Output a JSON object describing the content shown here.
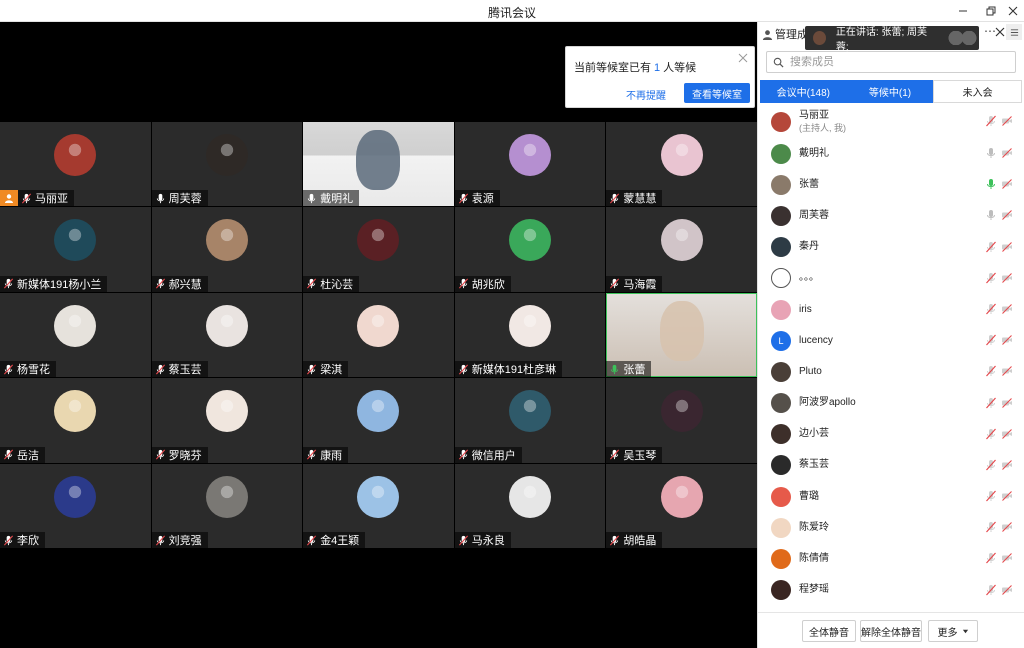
{
  "window": {
    "title": "腾讯会议"
  },
  "popup": {
    "prefix": "当前等候室已有",
    "count": "1",
    "suffix": "人等候",
    "dismiss_label": "不再提醒",
    "view_label": "查看等候室"
  },
  "speaking": {
    "text": "正在讲话: 张蕾; 周芙蓉;"
  },
  "panel": {
    "title": "管理成员",
    "search_placeholder": "搜索成员",
    "tabs": [
      {
        "label": "会议中(148)",
        "active": true
      },
      {
        "label": "等候中(1)",
        "active": false
      },
      {
        "label": "未入会",
        "active": false
      }
    ],
    "members": [
      {
        "name": "马丽亚",
        "sub": "(主持人, 我)",
        "mic": "muted",
        "color": "#b5473a"
      },
      {
        "name": "戴明礼",
        "sub": "",
        "mic": "idle",
        "color": "#4c8a4a"
      },
      {
        "name": "张蕾",
        "sub": "",
        "mic": "speaking",
        "color": "#8a7a6a"
      },
      {
        "name": "周芙蓉",
        "sub": "",
        "mic": "idle",
        "color": "#3a3130"
      },
      {
        "name": "秦丹",
        "sub": "",
        "mic": "muted",
        "color": "#2d3b45"
      },
      {
        "name": "。。。",
        "sub": "",
        "mic": "muted",
        "color": "#ffffff"
      },
      {
        "name": "iris",
        "sub": "",
        "mic": "muted",
        "color": "#e8a3b5"
      },
      {
        "name": "lucency",
        "sub": "",
        "mic": "muted",
        "color": "#1e6fe8",
        "letter": "L"
      },
      {
        "name": "Pluto",
        "sub": "",
        "mic": "muted",
        "color": "#4a3f38"
      },
      {
        "name": "阿波罗apollo",
        "sub": "",
        "mic": "muted",
        "color": "#55504a"
      },
      {
        "name": "边小芸",
        "sub": "",
        "mic": "muted",
        "color": "#3d2f2a"
      },
      {
        "name": "蔡玉芸",
        "sub": "",
        "mic": "muted",
        "color": "#2a2a2a"
      },
      {
        "name": "曹璐",
        "sub": "",
        "mic": "muted",
        "color": "#e65a4a"
      },
      {
        "name": "陈爱玲",
        "sub": "",
        "mic": "muted",
        "color": "#f1d7c2"
      },
      {
        "name": "陈倩倩",
        "sub": "",
        "mic": "muted",
        "color": "#e06a1a"
      },
      {
        "name": "程梦瑶",
        "sub": "",
        "mic": "muted",
        "color": "#3a2622"
      }
    ],
    "footer": {
      "mute_all": "全体静音",
      "unmute_all": "解除全体静音",
      "more": "更多"
    }
  },
  "tiles": [
    {
      "name": "马丽亚",
      "host": true,
      "mic": "muted",
      "color": "#a53a2f"
    },
    {
      "name": "周芙蓉",
      "mic": "idle",
      "color": "#2e2926"
    },
    {
      "name": "戴明礼",
      "mic": "idle",
      "video": true,
      "color": "#5b6a7a"
    },
    {
      "name": "袁源",
      "mic": "muted",
      "color": "#b58fd0"
    },
    {
      "name": "蒙慧慧",
      "mic": "muted",
      "color": "#e9c4d1"
    },
    {
      "name": "新媒体191杨小兰",
      "mic": "muted",
      "color": "#1f4a5a"
    },
    {
      "name": "郝兴慧",
      "mic": "muted",
      "color": "#a78468"
    },
    {
      "name": "杜沁芸",
      "mic": "muted",
      "color": "#5a2024"
    },
    {
      "name": "胡兆欣",
      "mic": "muted",
      "color": "#3aa85a"
    },
    {
      "name": "马海霞",
      "mic": "muted",
      "color": "#d1c4c8"
    },
    {
      "name": "杨雪花",
      "mic": "muted",
      "color": "#e6e2dc"
    },
    {
      "name": "蔡玉芸",
      "mic": "muted",
      "color": "#e9e3e0"
    },
    {
      "name": "梁淇",
      "mic": "muted",
      "color": "#f0d8cf"
    },
    {
      "name": "新媒体191杜彦琳",
      "mic": "muted",
      "color": "#f1e8e4"
    },
    {
      "name": "张蕾",
      "mic": "speaking",
      "video": true,
      "active": true,
      "color": "#d7c2ad"
    },
    {
      "name": "岳洁",
      "mic": "muted",
      "color": "#e9d7b0"
    },
    {
      "name": "罗晓芬",
      "mic": "muted",
      "color": "#f0e6de"
    },
    {
      "name": "康雨",
      "mic": "muted",
      "color": "#8fb6e0"
    },
    {
      "name": "微信用户",
      "mic": "muted",
      "color": "#2f5a6a"
    },
    {
      "name": "吴玉琴",
      "mic": "muted",
      "color": "#3a2630"
    },
    {
      "name": "李欣",
      "mic": "muted",
      "color": "#2b3a8a"
    },
    {
      "name": "刘竞强",
      "mic": "muted",
      "color": "#7a7874"
    },
    {
      "name": "金4王颖",
      "mic": "muted",
      "color": "#9cc2e6"
    },
    {
      "name": "马永良",
      "mic": "muted",
      "color": "#e6e6e6"
    },
    {
      "name": "胡皓晶",
      "mic": "muted",
      "color": "#e6a6b0"
    }
  ]
}
